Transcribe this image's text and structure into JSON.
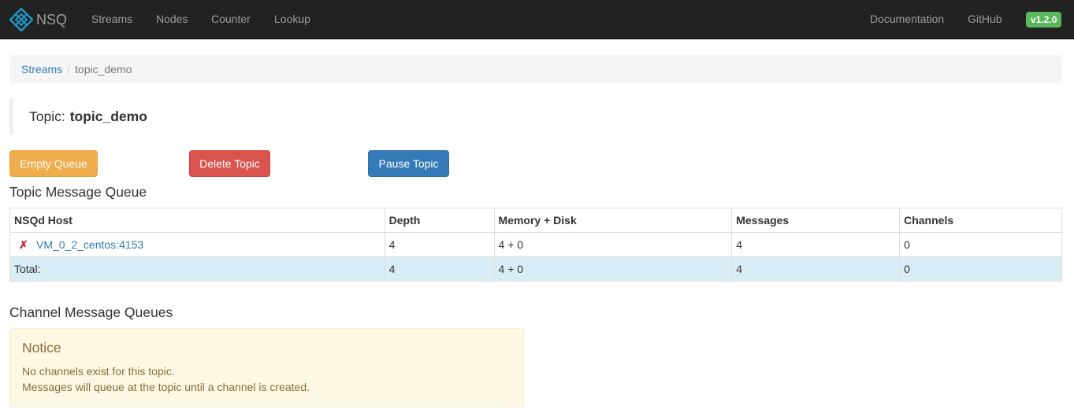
{
  "navbar": {
    "brand": "NSQ",
    "logo_icon": "nsq-logo-icon",
    "links": [
      "Streams",
      "Nodes",
      "Counter",
      "Lookup"
    ],
    "right_links": [
      "Documentation",
      "GitHub"
    ],
    "version": "v1.2.0"
  },
  "breadcrumb": {
    "parent": "Streams",
    "separator": "/",
    "current": "topic_demo"
  },
  "topic": {
    "label": "Topic:",
    "name": "topic_demo"
  },
  "actions": {
    "empty_queue": "Empty Queue",
    "delete_topic": "Delete Topic",
    "pause_topic": "Pause Topic"
  },
  "topic_queue": {
    "title": "Topic Message Queue",
    "columns": [
      "NSQd Host",
      "Depth",
      "Memory + Disk",
      "Messages",
      "Channels"
    ],
    "rows": [
      {
        "status_icon": "x-mark-icon",
        "status_mark": "✗",
        "host": "VM_0_2_centos:4153",
        "depth": "4",
        "memory_disk": "4 + 0",
        "messages": "4",
        "channels": "0"
      }
    ],
    "total": {
      "label": "Total:",
      "depth": "4",
      "memory_disk": "4 + 0",
      "messages": "4",
      "channels": "0"
    }
  },
  "channel_queues": {
    "title": "Channel Message Queues",
    "notice_title": "Notice",
    "notice_lines": [
      "No channels exist for this topic.",
      "Messages will queue at the topic until a channel is created."
    ]
  },
  "colors": {
    "navbar_bg": "#222222",
    "link": "#337ab7",
    "warning": "#f0ad4e",
    "danger": "#d9534f",
    "primary": "#337ab7",
    "success": "#5cb85c",
    "total_row_bg": "#d9edf7",
    "notice_bg": "#fcf8e3",
    "notice_text": "#8a6d3b",
    "logo": "#2196c8"
  }
}
